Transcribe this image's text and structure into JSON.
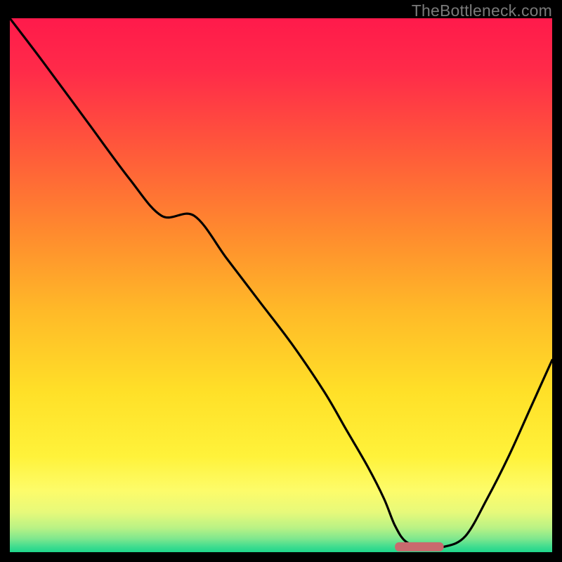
{
  "watermark": "TheBottleneck.com",
  "colors": {
    "gradient_stops": [
      {
        "offset": 0.0,
        "color": "#ff1a4b"
      },
      {
        "offset": 0.1,
        "color": "#ff2b49"
      },
      {
        "offset": 0.25,
        "color": "#ff5a3a"
      },
      {
        "offset": 0.4,
        "color": "#ff8a2e"
      },
      {
        "offset": 0.55,
        "color": "#ffba28"
      },
      {
        "offset": 0.7,
        "color": "#ffe028"
      },
      {
        "offset": 0.82,
        "color": "#fff23a"
      },
      {
        "offset": 0.885,
        "color": "#fdfc6a"
      },
      {
        "offset": 0.925,
        "color": "#e7f97a"
      },
      {
        "offset": 0.955,
        "color": "#b8f285"
      },
      {
        "offset": 0.975,
        "color": "#7ee78e"
      },
      {
        "offset": 0.99,
        "color": "#3fdc8f"
      },
      {
        "offset": 1.0,
        "color": "#1fd68c"
      }
    ],
    "curve": "#000000",
    "bar": "#c96a6e",
    "frame_bg": "#000000",
    "watermark": "#7a7a7a"
  },
  "chart_data": {
    "type": "line",
    "title": "",
    "xlabel": "",
    "ylabel": "",
    "xlim": [
      0,
      100
    ],
    "ylim": [
      0,
      100
    ],
    "grid": false,
    "legend": false,
    "x": [
      0,
      6,
      14,
      22,
      28,
      34,
      40,
      46,
      52,
      58,
      62,
      66,
      69,
      71,
      73,
      76,
      80,
      84,
      88,
      92,
      96,
      100
    ],
    "values": [
      100,
      92,
      81,
      70,
      63,
      63,
      55,
      47,
      39,
      30,
      23,
      16,
      10,
      5,
      2,
      1,
      1,
      3,
      10,
      18,
      27,
      36
    ],
    "optimal_band": {
      "x_start": 71,
      "x_end": 80,
      "y": 1
    }
  }
}
